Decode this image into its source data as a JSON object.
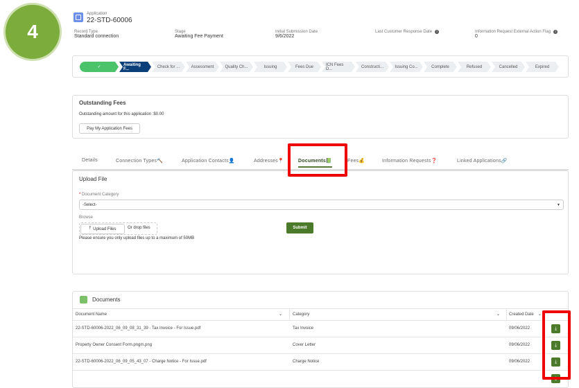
{
  "step_badge": "4",
  "header": {
    "object_label": "Application",
    "record_name": "22-STD-60006"
  },
  "fields": [
    {
      "label": "Record Type",
      "value": "Standard connection"
    },
    {
      "label": "Stage",
      "value": "Awaiting Fee Payment"
    },
    {
      "label": "Initial Submission Date",
      "value": "9/6/2022"
    },
    {
      "label": "Last Customer Response Date",
      "value": ""
    },
    {
      "label": "Information Request External Action Flag",
      "value": "0"
    }
  ],
  "path": [
    "✓",
    "Awaiting F...",
    "Check for ...",
    "Assessment",
    "Quality Ch...",
    "Issuing",
    "Fees Due",
    "ICN Fees D...",
    "Constructi...",
    "Issuing Co...",
    "Complete",
    "Refused",
    "Cancelled",
    "Expired"
  ],
  "fees": {
    "title": "Outstanding Fees",
    "text": "Outstanding amount for this application :$0.00",
    "button": "Pay My Application Fees"
  },
  "tabs": [
    "Details",
    "Connection Types🔨",
    "Application Contacts👤",
    "Addresses📍",
    "Documents📗",
    "Fees💰",
    "Information Requests❓",
    "Linked Applications🔗"
  ],
  "upload": {
    "title": "Upload File",
    "required_mark": "*",
    "category_label": "Document Category",
    "category_value": "-Select-",
    "browse_label": "Browse",
    "upload_button": "Upload Files",
    "drop_text": "Or drop files",
    "submit": "Submit",
    "note": "Please ensure you only upload files up to a maximum of 50MB"
  },
  "documents": {
    "title": "Documents",
    "columns": [
      "Document Name",
      "Category",
      "Created Date"
    ],
    "rows": [
      {
        "name": "22-STD-60006-2022_06_09_08_31_39 - Tax Invoice - For Issue.pdf",
        "category": "Tax Invoice",
        "date": "09/06/2022"
      },
      {
        "name": "Property Owner Consent Form.pngm.png",
        "category": "Cover Letter",
        "date": "09/06/2022"
      },
      {
        "name": "22-STD-60006-2022_06_09_05_43_07 - Charge Notice - For Issue.pdf",
        "category": "Charge Notice",
        "date": "09/06/2022"
      }
    ]
  },
  "colors": {
    "accent": "#4b7a2b",
    "path_current": "#0b3f79",
    "path_done": "#4bc36a",
    "highlight": "#ee0000",
    "badge": "#7cac3c"
  }
}
